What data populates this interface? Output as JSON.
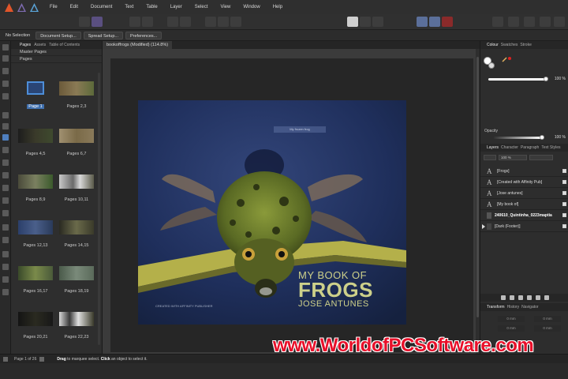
{
  "menu": [
    "File",
    "Edit",
    "Document",
    "Text",
    "Table",
    "Layer",
    "Select",
    "View",
    "Window",
    "Help"
  ],
  "context": {
    "selection": "No Selection",
    "document_setup": "Document Setup...",
    "spread_setup": "Spread Setup...",
    "preferences": "Preferences..."
  },
  "pages_panel": {
    "tabs": [
      "Pages",
      "Assets",
      "Table of Contents"
    ],
    "master_pages": "Master Pages",
    "pages": "Pages",
    "page_labels": [
      "Page 1",
      "Pages 2,3",
      "Pages 4,5",
      "Pages 6,7",
      "Pages 8,9",
      "Pages 10,11",
      "Pages 12,13",
      "Pages 14,15",
      "Pages 16,17",
      "Pages 18,19",
      "Pages 20,21",
      "Pages 22,23"
    ]
  },
  "document": {
    "tab_title": "bookoffrogs (Modified) (114.8%)",
    "cover_line1": "MY BOOK OF",
    "cover_line2": "FROGS",
    "cover_line3": "JOSE ANTUNES",
    "cover_credit": "CREATED WITH AFFINITY PUBLISHER",
    "cover_note": "My frozen frog"
  },
  "right_panel": {
    "colour_tabs": [
      "Colour",
      "Swatches",
      "Stroke"
    ],
    "colour_value": "100 %",
    "opacity_label": "Opacity",
    "opacity_value": "100 %",
    "layer_tabs": [
      "Layers",
      "Character",
      "Paragraph",
      "Text Styles"
    ],
    "layer_opacity": "100 %",
    "layers": [
      "[Frogs]",
      "[Created with Affinity Pub]",
      "[Jose antunes]",
      "[My book of]",
      "240610_Quintinha_0223maptia",
      "[Dark (Footer)]"
    ],
    "transform_tabs": [
      "Transform",
      "History",
      "Navigator"
    ],
    "transform_fields": [
      "0 mm",
      "0 mm",
      "0 mm",
      "0 mm"
    ]
  },
  "status": {
    "page_indicator": "Page 1 of 26",
    "drag": "Drag",
    "drag_rest": " to marquee select. ",
    "click": "Click",
    "click_rest": " an object to select it."
  },
  "watermark": "www.WorldofPCSoftware.com",
  "colors": {
    "accent_red": "#e02020",
    "watermark_red": "#e8102a",
    "cover_text": "#cdd08a"
  }
}
